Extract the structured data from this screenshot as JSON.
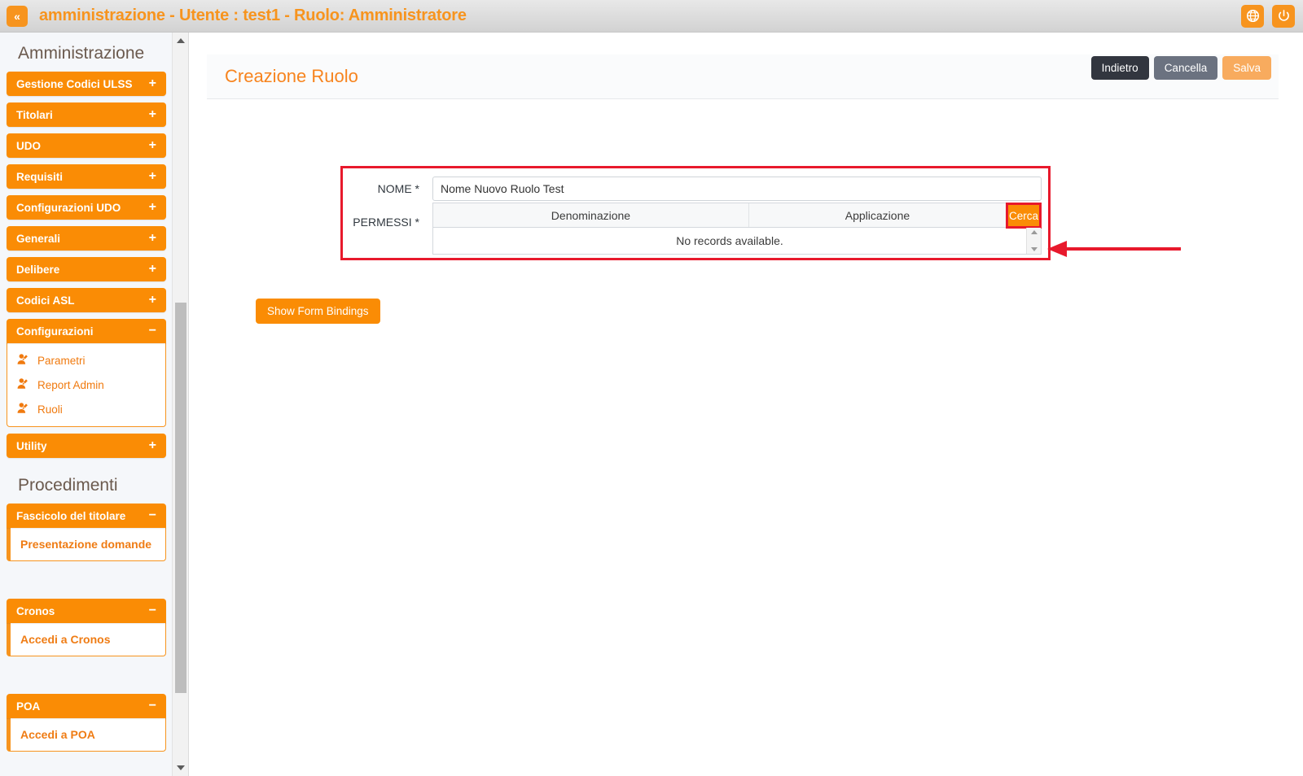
{
  "topbar": {
    "collapse_label": "«",
    "title": "amministrazione - Utente : test1 - Ruolo: Amministratore",
    "language_icon": "globe-icon",
    "power_icon": "power-icon",
    "accent_color": "#f7941e"
  },
  "sidebar": {
    "sections": [
      {
        "title": "Amministrazione",
        "groups": [
          {
            "label": "Gestione Codici ULSS",
            "sign": "+",
            "expanded": false,
            "items": []
          },
          {
            "label": "Titolari",
            "sign": "+",
            "expanded": false,
            "items": []
          },
          {
            "label": "UDO",
            "sign": "+",
            "expanded": false,
            "items": []
          },
          {
            "label": "Requisiti",
            "sign": "+",
            "expanded": false,
            "items": []
          },
          {
            "label": "Configurazioni UDO",
            "sign": "+",
            "expanded": false,
            "items": []
          },
          {
            "label": "Generali",
            "sign": "+",
            "expanded": false,
            "items": []
          },
          {
            "label": "Delibere",
            "sign": "+",
            "expanded": false,
            "items": []
          },
          {
            "label": "Codici ASL",
            "sign": "+",
            "expanded": false,
            "items": []
          },
          {
            "label": "Configurazioni",
            "sign": "−",
            "expanded": true,
            "items": [
              {
                "label": "Parametri",
                "icon": "user-edit-icon"
              },
              {
                "label": "Report Admin",
                "icon": "user-edit-icon"
              },
              {
                "label": "Ruoli",
                "icon": "user-edit-icon"
              }
            ]
          },
          {
            "label": "Utility",
            "sign": "+",
            "expanded": false,
            "items": []
          }
        ]
      },
      {
        "title": "Procedimenti",
        "groups": [
          {
            "label": "Fascicolo del titolare",
            "sign": "−",
            "expanded": true,
            "items": [
              {
                "label": "Presentazione domande",
                "icon": ""
              }
            ]
          },
          {
            "label": "Cronos",
            "sign": "−",
            "expanded": true,
            "items": [
              {
                "label": "Accedi a Cronos",
                "icon": ""
              }
            ]
          },
          {
            "label": "POA",
            "sign": "−",
            "expanded": true,
            "items": [
              {
                "label": "Accedi a POA",
                "icon": ""
              }
            ]
          }
        ]
      }
    ],
    "scrollbar": {
      "up_icon": "triangle-up-icon",
      "down_icon": "triangle-down-icon"
    }
  },
  "main": {
    "page_title": "Creazione Ruolo",
    "header_buttons": [
      {
        "label": "Indietro",
        "style": "dark"
      },
      {
        "label": "Cancella",
        "style": "gray"
      },
      {
        "label": "Salva",
        "style": "orange"
      }
    ],
    "form": {
      "nome": {
        "label": "NOME *",
        "value": "Nome Nuovo Ruolo Test",
        "placeholder": ""
      },
      "permessi": {
        "label": "PERMESSI *",
        "columns": [
          "Denominazione",
          "Applicazione"
        ],
        "search_button": "Cerca",
        "empty_text": "No records available.",
        "rows": []
      },
      "highlight_color": "#e8192c"
    },
    "show_bindings_button": "Show Form Bindings",
    "annotation": {
      "type": "arrow",
      "color": "#e8192c",
      "points_to": "Cerca"
    }
  }
}
